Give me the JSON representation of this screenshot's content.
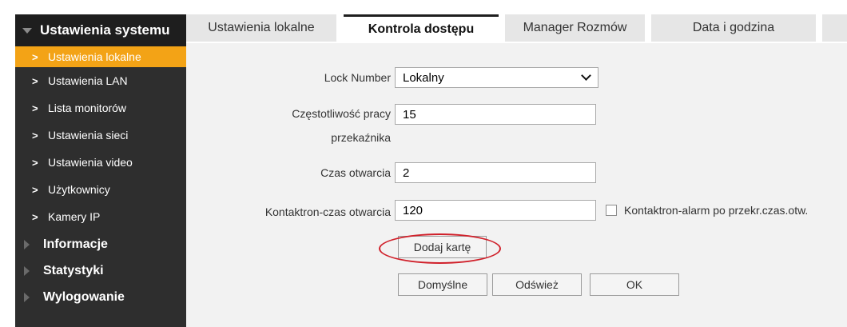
{
  "sidebar": {
    "header": "Ustawienia systemu",
    "items": [
      {
        "label": "Ustawienia lokalne",
        "active": true
      },
      {
        "label": "Ustawienia LAN"
      },
      {
        "label": "Lista monitorów"
      },
      {
        "label": "Ustawienia sieci"
      },
      {
        "label": "Ustawienia video"
      },
      {
        "label": "Użytkownicy"
      },
      {
        "label": "Kamery IP"
      }
    ],
    "main_sections": [
      "Informacje",
      "Statystyki",
      "Wylogowanie"
    ]
  },
  "tabs": [
    {
      "label": "Ustawienia lokalne"
    },
    {
      "label": "Kontrola dostępu",
      "active": true
    },
    {
      "label": "Manager Rozmów"
    },
    {
      "label": "Data i godzina"
    }
  ],
  "form": {
    "lock_number": {
      "label": "Lock Number",
      "value": "Lokalny"
    },
    "relay_freq": {
      "label_line1": "Częstotliwość pracy",
      "label_line2": "przekaźnika",
      "value": "15"
    },
    "open_time": {
      "label": "Czas otwarcia",
      "value": "2"
    },
    "contact_time": {
      "label": "Kontaktron-czas otwarcia",
      "value": "120"
    },
    "contact_alarm": {
      "label": "Kontaktron-alarm po przekr.czas.otw.",
      "checked": false
    }
  },
  "buttons": {
    "add_card": "Dodaj kartę",
    "default": "Domyślne",
    "refresh": "Odśwież",
    "ok": "OK"
  },
  "colors": {
    "accent": "#f3a316",
    "sidebar_bg": "#2e2e2e",
    "highlight_ellipse": "#d0202a"
  }
}
